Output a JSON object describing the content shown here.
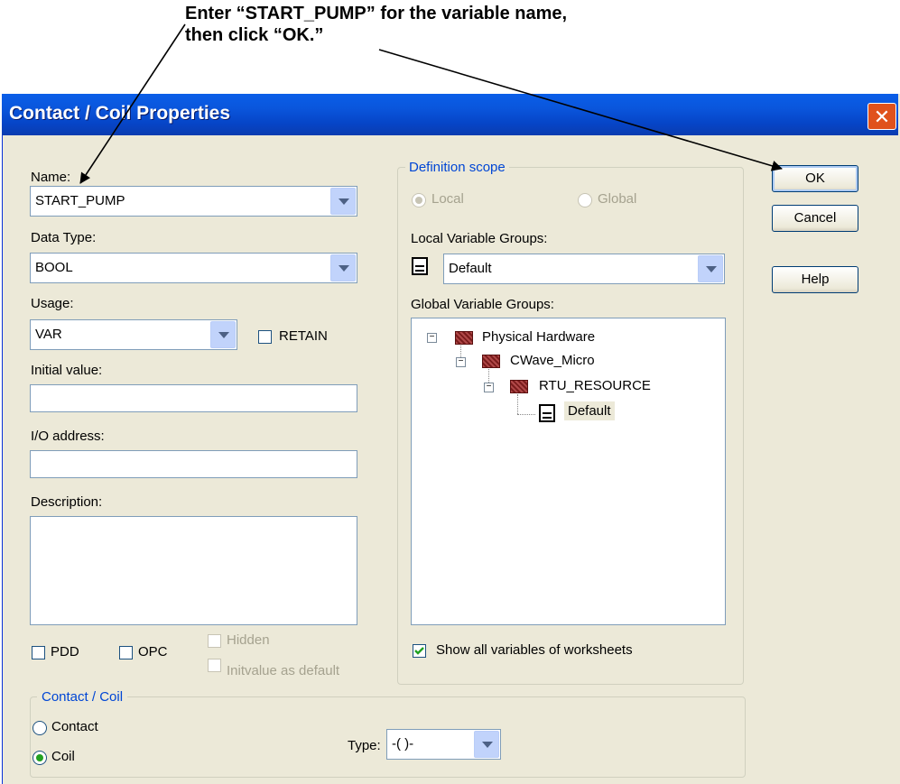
{
  "callout": {
    "line1": "Enter “START_PUMP” for the variable name,",
    "line2": "then click “OK.”"
  },
  "dialog": {
    "title": "Contact / Coil Properties",
    "close_icon": "close-x-icon"
  },
  "left": {
    "name_label": "Name:",
    "name_value": "START_PUMP",
    "datatype_label": "Data Type:",
    "datatype_value": "BOOL",
    "usage_label": "Usage:",
    "usage_value": "VAR",
    "retain_label": "RETAIN",
    "initial_label": "Initial value:",
    "initial_value": "",
    "io_label": "I/O address:",
    "io_value": "",
    "description_label": "Description:",
    "description_value": "",
    "pdd_label": "PDD",
    "opc_label": "OPC",
    "hidden_label": "Hidden",
    "initvalue_label": "Initvalue as default"
  },
  "scope": {
    "legend": "Definition scope",
    "local_label": "Local",
    "global_label": "Global",
    "selected": "Local",
    "local_groups_label": "Local Variable Groups:",
    "local_groups_value": "Default",
    "global_groups_label": "Global Variable Groups:",
    "tree": {
      "root": "Physical Hardware",
      "child": "CWave_Micro",
      "grandchild": "RTU_RESOURCE",
      "leaf": "Default"
    },
    "show_all_label": "Show all variables of worksheets",
    "show_all_checked": true
  },
  "buttons": {
    "ok": "OK",
    "cancel": "Cancel",
    "help": "Help"
  },
  "contact_coil": {
    "legend": "Contact / Coil",
    "contact_label": "Contact",
    "coil_label": "Coil",
    "selected": "Coil",
    "type_label": "Type:",
    "type_value": "-( )-"
  }
}
